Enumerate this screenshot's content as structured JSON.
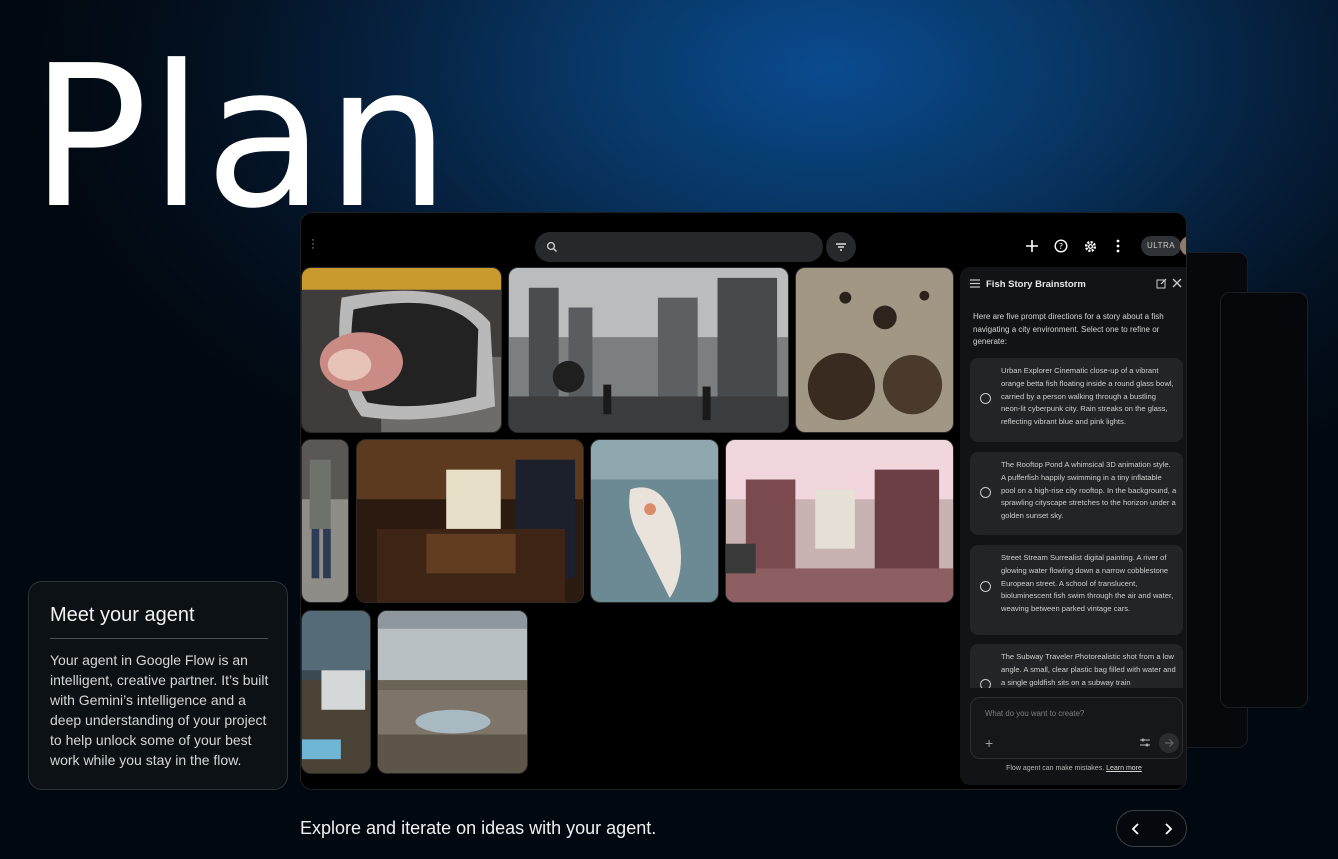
{
  "hero": {
    "title": "Plan"
  },
  "app": {
    "search": {
      "placeholder": ""
    },
    "ultra_badge": "ULTRA",
    "icons": [
      "menu-dots-icon",
      "search-icon",
      "filter-icon",
      "plus-icon",
      "help-icon",
      "gear-icon",
      "more-vert-icon"
    ]
  },
  "panel": {
    "title": "Fish Story Brainstorm",
    "intro": "Here are five prompt directions for a story about a fish navigating a city environment. Select one to refine or generate:",
    "options": [
      {
        "text": "Urban Explorer Cinematic close-up of a vibrant orange betta fish floating inside a round glass bowl, carried by a person walking through a bustling neon-lit cyberpunk city. Rain streaks on the glass, reflecting vibrant blue and pink lights."
      },
      {
        "text": "The Rooftop Pond A whimsical 3D animation style. A pufferfish happily swimming in a tiny inflatable pool on a high-rise city rooftop. In the background, a sprawling cityscape stretches to the horizon under a golden sunset sky."
      },
      {
        "text": "Street Stream Surrealist digital painting. A river of glowing water flowing down a narrow cobblestone European street. A school of translucent, bioluminescent fish swim through the air and water, weaving between parked vintage cars."
      },
      {
        "text": "The Subway Traveler Photorealistic shot from a low angle. A small, clear plastic bag filled with water and a single goldfish sits on a subway train"
      }
    ],
    "prompt_placeholder": "What do you want to create?",
    "footer_text": "Flow agent can make mistakes.",
    "footer_link": "Learn more"
  },
  "agent_card": {
    "title": "Meet your agent",
    "body": "Your agent in Google Flow is an intelligent, creative partner. It’s built with Gemini’s intelligence and a deep understanding of your project to help unlock some of your best work while you stay in the flow."
  },
  "caption": "Explore and iterate on ideas with your agent.",
  "colors": {
    "accent_blue": "#0a4b8f",
    "panel_bg": "#111316",
    "card_bg": "#222428"
  }
}
